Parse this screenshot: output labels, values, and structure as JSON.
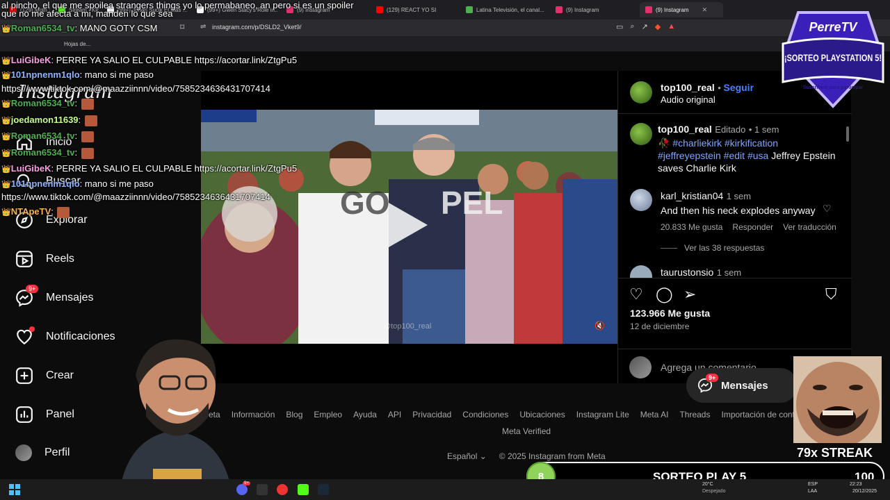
{
  "browser": {
    "tabs": [
      {
        "label": "(129) Moth To A Flam...",
        "icon_color": "#ff0000"
      },
      {
        "label": "Stream - Kick Dashbo...",
        "icon_color": "#53fc18"
      },
      {
        "label": "(99+) Johan Suclk El Más ...",
        "icon_color": "#ffffff"
      },
      {
        "label": "(99+) Gwen Stacy's Role in...",
        "icon_color": "#ffffff"
      },
      {
        "label": "(9) Instagram",
        "icon_color": "#e1306c"
      },
      {
        "label": "(129) REACT YO SI",
        "icon_color": "#ff0000"
      },
      {
        "label": "Latina Televisión, el canal...",
        "icon_color": "#4caf50"
      },
      {
        "label": "(9) Instagram",
        "icon_color": "#e1306c"
      },
      {
        "label": "(9) Instagram",
        "icon_color": "#e1306c",
        "active": true
      }
    ],
    "url": "instagram.com/p/DSLD2_Vket9/",
    "bookmark_label": "Hojas de..."
  },
  "instagram": {
    "logo": "Instagram",
    "nav": [
      {
        "label": "Inicio",
        "icon": "home-icon"
      },
      {
        "label": "Buscar",
        "icon": "search-icon"
      },
      {
        "label": "Explorar",
        "icon": "compass-icon"
      },
      {
        "label": "Reels",
        "icon": "reels-icon"
      },
      {
        "label": "Mensajes",
        "icon": "messenger-icon",
        "badge": "9+"
      },
      {
        "label": "Notificaciones",
        "icon": "heart-icon",
        "dot": true
      },
      {
        "label": "Crear",
        "icon": "plus-icon"
      },
      {
        "label": "Panel",
        "icon": "chart-icon"
      },
      {
        "label": "Perfil",
        "icon": "avatar"
      }
    ],
    "post": {
      "author": "top100_real",
      "follow": "Seguir",
      "audio": "Audio original",
      "caption_author": "top100_real",
      "caption_edited": "Editado",
      "caption_time": "1 sem",
      "caption_tags": "#charliekirk #kirkification #jeffreyepstein #edit #usa",
      "caption_text": "Jeffrey Epstein saves Charlie Kirk",
      "video_watermark": "@top100_real",
      "comments": [
        {
          "user": "karl_kristian04",
          "time": "1 sem",
          "text": "And then his neck explodes anyway",
          "likes": "20.833 Me gusta",
          "reply": "Responder",
          "translate": "Ver traducción",
          "view_replies": "Ver las 38 respuestas"
        },
        {
          "user": "taurustonsio",
          "time": "1 sem"
        }
      ],
      "like_count": "123.966 Me gusta",
      "date": "12 de diciembre",
      "comment_placeholder": "Agrega un comentario..."
    },
    "footer": {
      "links": [
        "Meta",
        "Información",
        "Blog",
        "Empleo",
        "Ayuda",
        "API",
        "Privacidad",
        "Condiciones",
        "Ubicaciones",
        "Instagram Lite",
        "Meta AI",
        "Threads",
        "Importación de contac"
      ],
      "verified": "Meta Verified",
      "language": "Español",
      "copyright": "© 2025 Instagram from Meta"
    },
    "messages_pill": {
      "label": "Mensajes",
      "badge": "9+"
    }
  },
  "stream_overlay": {
    "chat": [
      {
        "user": "",
        "text": "al pincho, el que me spoilea strangers things yo lo permabaneo, an pero si es un spoiler"
      },
      {
        "user": "",
        "text": "que no me afecta a mi, manden lo que sea"
      },
      {
        "user": "Roman6534_tv",
        "text": "MANO GOTY CSM",
        "user_color": "#4caf50"
      },
      {
        "user": "LuiGibeK",
        "text": "PERRE YA SALIO EL CULPABLE https://acortar.link/ZtgPu5",
        "user_color": "#ff9ee8"
      },
      {
        "user": "101npnenm1qlo",
        "text": "mano si me paso",
        "user_color": "#8fb4ff"
      },
      {
        "user": "",
        "text": "https://www.tiktok.com/@maazziinnn/video/7585234636431707414"
      },
      {
        "user": "Roman6534_tv",
        "text": "",
        "user_color": "#4caf50"
      },
      {
        "user": "joedamon11639",
        "text": "",
        "user_color": "#c6ff8a"
      },
      {
        "user": "Roman6534_tv",
        "text": "",
        "user_color": "#4caf50"
      },
      {
        "user": "Roman6534_tv",
        "text": "",
        "user_color": "#4caf50"
      },
      {
        "user": "LuiGibeK",
        "text": "PERRE YA SALIO EL CULPABLE https://acortar.link/ZtgPu5",
        "user_color": "#ff9ee8"
      },
      {
        "user": "101npnenm1qlo",
        "text": "mano si me paso",
        "user_color": "#8fb4ff"
      },
      {
        "user": "",
        "text": "https://www.tiktok.com/@maazziinnn/video/7585234636431707414"
      },
      {
        "user": "NTApeTV",
        "text": "",
        "user_color": "#ffb14a"
      }
    ],
    "sorteo": {
      "brand": "PerreTV",
      "title": "¡SORTEO PLAYSTATION 5!",
      "subtitle": "Suscríbete para participar"
    },
    "streak": "79x STREAK",
    "raffle": {
      "number": "8",
      "title": "SORTEO PLAY 5",
      "count": "100"
    }
  },
  "taskbar": {
    "weather": "20°C",
    "weather_sub": "Despejado",
    "lang": "ESP",
    "lang_sub": "LAA",
    "time": "22:23",
    "date": "20/12/2025",
    "discord_badge": "9+"
  }
}
